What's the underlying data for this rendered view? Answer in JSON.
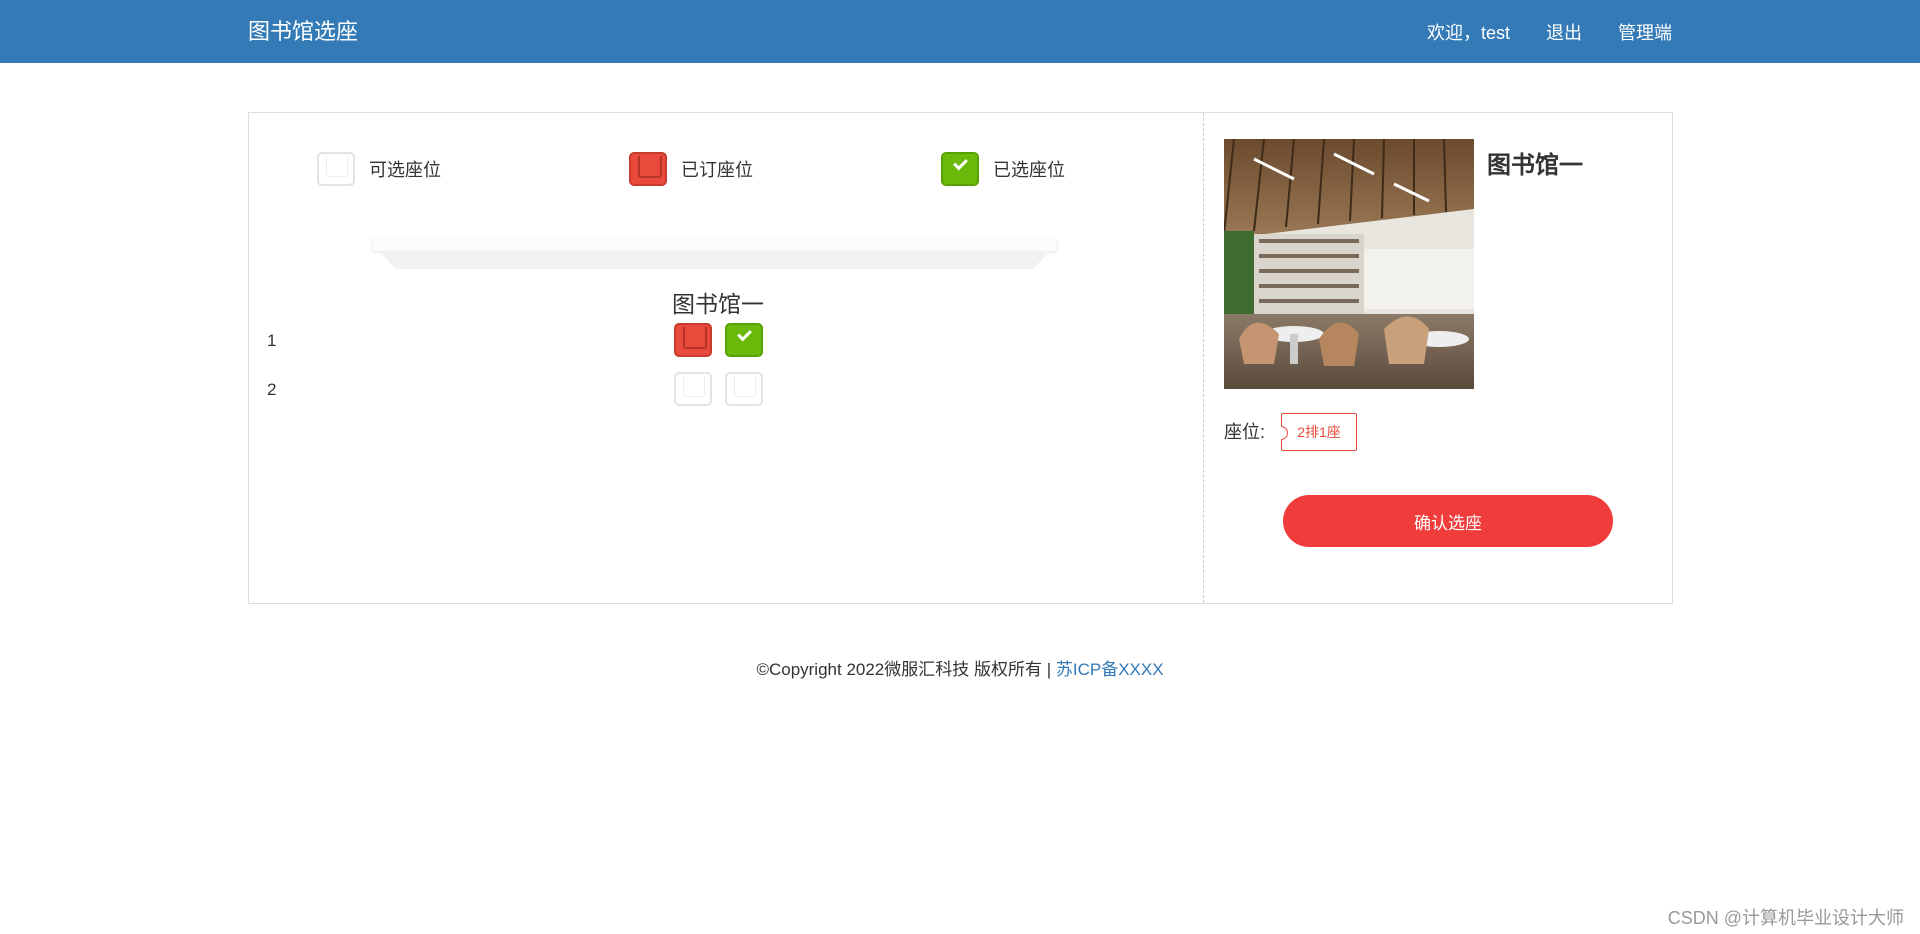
{
  "navbar": {
    "brand": "图书馆选座",
    "welcome": "欢迎，test",
    "logout": "退出",
    "admin": "管理端",
    "bg_color": "#337ab7"
  },
  "legend": [
    {
      "status": "available",
      "label": "可选座位"
    },
    {
      "status": "booked",
      "label": "已订座位"
    },
    {
      "status": "selected",
      "label": "已选座位"
    }
  ],
  "hall": {
    "name": "图书馆一",
    "rows": [
      {
        "label": "1",
        "seats": [
          "booked",
          "selected"
        ]
      },
      {
        "label": "2",
        "seats": [
          "available",
          "available"
        ]
      }
    ]
  },
  "info": {
    "title": "图书馆一",
    "thumbnail": "library-interior-photo",
    "seat_label": "座位:",
    "selected_seat": "2排1座",
    "confirm_label": "确认选座",
    "accent_color": "#f03d3b"
  },
  "footer": {
    "copyright": "©Copyright 2022微服汇科技 版权所有 | ",
    "icp": "苏ICP备XXXX"
  },
  "watermark": "CSDN @计算机毕业设计大师"
}
